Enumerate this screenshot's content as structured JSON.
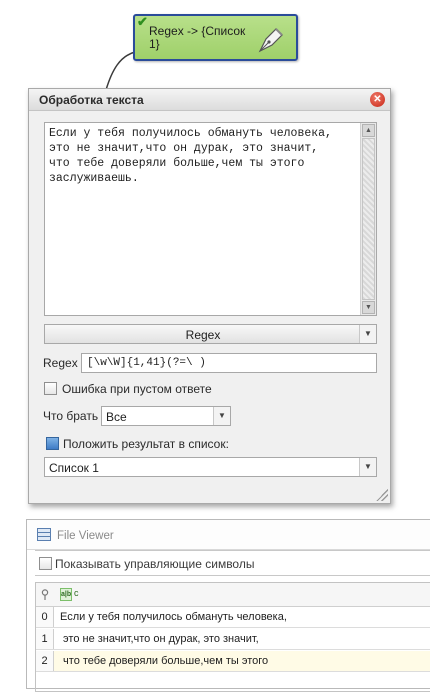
{
  "node": {
    "title": "Regex -> {Список\n1}",
    "status_icon": "check-icon"
  },
  "dialog": {
    "title": "Обработка текста",
    "text": "Если у тебя получилось обмануть человека,\nэто не значит,что он дурак, это значит,\nчто тебе доверяли больше,чем ты этого\nзаслуживаешь.",
    "mode": "Regex",
    "regex_label": "Regex",
    "regex_value": "[\\w\\W]{1,41}(?=\\ )",
    "error_checkbox_label": "Ошибка при пустом ответе",
    "what_label": "Что брать",
    "what_value": "Все",
    "list_checkbox_label": "Положить результат в список:",
    "list_value": "Список 1"
  },
  "viewer": {
    "title": "File Viewer",
    "show_ctrl_label": "Показывать управляющие символы",
    "rows": [
      {
        "index": "0",
        "text": "Если у тебя получилось обмануть человека,"
      },
      {
        "index": "1",
        "text": " это не значит,что он дурак, это значит,"
      },
      {
        "index": "2",
        "text": " что тебе доверяли больше,чем ты этого"
      }
    ]
  },
  "colors": {
    "node_fill": "#9fd06a",
    "node_border": "#2a4c9a",
    "close": "#c62414",
    "highlight_row": "#fffbe6"
  }
}
